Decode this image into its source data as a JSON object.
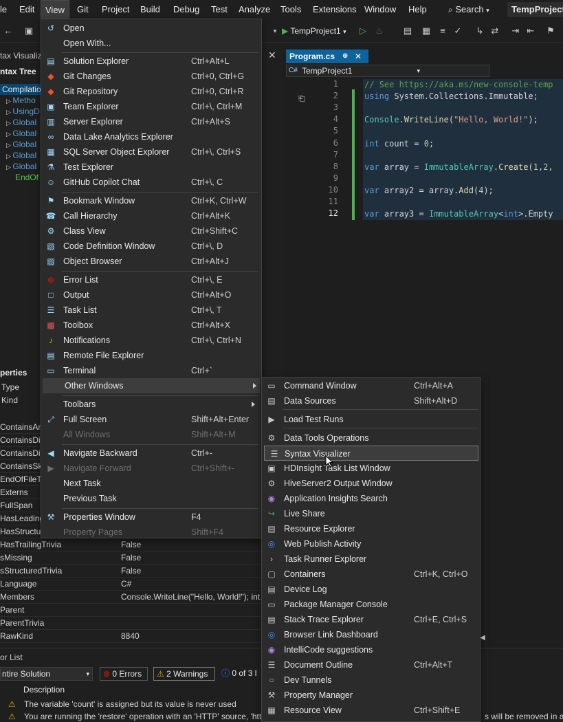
{
  "menubar": {
    "items": [
      "le",
      "Edit",
      "View",
      "Git",
      "Project",
      "Build",
      "Debug",
      "Test",
      "Analyze",
      "Tools",
      "Extensions",
      "Window",
      "Help"
    ],
    "search": "Search",
    "project": "TempProject1"
  },
  "toolbar": {
    "run_target": "TempProject1"
  },
  "left_panel": {
    "panel_title": "tax Visualiz",
    "tree_title": "ntax Tree",
    "tree_items": [
      "Compilatio",
      "Metho",
      "UsingD",
      "Global",
      "Global",
      "Global",
      "Global",
      "Global",
      "EndOf"
    ],
    "properties_title": "perties",
    "prop_header": [
      "Type",
      "Kind"
    ],
    "prop_names_top": [
      "ContainsAn",
      "ContainsDi",
      "ContainsDir",
      "ContainsSki",
      "EndOfFileTo",
      "Externs",
      "FullSpan",
      "HasLeading",
      "HasStructur"
    ],
    "props": [
      {
        "name": "HasTrailingTrivia",
        "value": "False"
      },
      {
        "name": "sMissing",
        "value": "False"
      },
      {
        "name": "sStructuredTrivia",
        "value": "False"
      },
      {
        "name": "Language",
        "value": "C#"
      },
      {
        "name": "Members",
        "value": "Console.WriteLine(\"Hello, World!\"); int"
      },
      {
        "name": "Parent",
        "value": ""
      },
      {
        "name": "ParentTrivia",
        "value": ""
      },
      {
        "name": "RawKind",
        "value": "8840"
      }
    ]
  },
  "editor": {
    "tab": "Program.cs",
    "navbar": "TempProject1",
    "lines": [
      {
        "n": "1",
        "text": "// See https://aka.ms/new-console-temp"
      },
      {
        "n": "2",
        "text": "using System.Collections.Immutable;"
      },
      {
        "n": "3",
        "text": ""
      },
      {
        "n": "4",
        "text": "Console.WriteLine(\"Hello, World!\");"
      },
      {
        "n": "5",
        "text": ""
      },
      {
        "n": "6",
        "text": "int count = 0;"
      },
      {
        "n": "7",
        "text": ""
      },
      {
        "n": "8",
        "text": "var array = ImmutableArray.Create(1,2,"
      },
      {
        "n": "9",
        "text": ""
      },
      {
        "n": "10",
        "text": "var array2 = array.Add(4);"
      },
      {
        "n": "11",
        "text": ""
      },
      {
        "n": "12",
        "text": "var array3 = ImmutableArray<int>.Empty"
      }
    ]
  },
  "error_list": {
    "title": "or List",
    "scope": "ntire Solution",
    "errors": "0 Errors",
    "warnings": "2 Warnings",
    "messages": "0 of 3 l",
    "col_description": "Description",
    "rows": [
      "The variable 'count' is assigned but its value is never used",
      "You are running the 'restore' operation with an 'HTTP' source, 'htt"
    ],
    "row2_tail": "s will be removed in a f"
  },
  "view_menu": [
    {
      "label": "Open",
      "shortcut": "",
      "icon": "open-icon"
    },
    {
      "label": "Open With...",
      "shortcut": "",
      "icon": ""
    },
    {
      "label": "Solution Explorer",
      "shortcut": "Ctrl+Alt+L",
      "icon": "solution-explorer-icon"
    },
    {
      "label": "Git Changes",
      "shortcut": "Ctrl+0, Ctrl+G",
      "icon": "git-changes-icon"
    },
    {
      "label": "Git Repository",
      "shortcut": "Ctrl+0, Ctrl+R",
      "icon": "git-repository-icon"
    },
    {
      "label": "Team Explorer",
      "shortcut": "Ctrl+\\, Ctrl+M",
      "icon": "team-explorer-icon"
    },
    {
      "label": "Server Explorer",
      "shortcut": "Ctrl+Alt+S",
      "icon": "server-explorer-icon"
    },
    {
      "label": "Data Lake Analytics Explorer",
      "shortcut": "",
      "icon": "data-lake-icon"
    },
    {
      "label": "SQL Server Object Explorer",
      "shortcut": "Ctrl+\\, Ctrl+S",
      "icon": "sql-server-icon"
    },
    {
      "label": "Test Explorer",
      "shortcut": "",
      "icon": "test-explorer-icon"
    },
    {
      "label": "GitHub Copilot Chat",
      "shortcut": "Ctrl+\\, C",
      "icon": "copilot-icon"
    },
    {
      "label": "Bookmark Window",
      "shortcut": "Ctrl+K, Ctrl+W",
      "icon": "bookmark-icon"
    },
    {
      "label": "Call Hierarchy",
      "shortcut": "Ctrl+Alt+K",
      "icon": "call-hierarchy-icon"
    },
    {
      "label": "Class View",
      "shortcut": "Ctrl+Shift+C",
      "icon": "class-view-icon"
    },
    {
      "label": "Code Definition Window",
      "shortcut": "Ctrl+\\, D",
      "icon": "code-definition-icon"
    },
    {
      "label": "Object Browser",
      "shortcut": "Ctrl+Alt+J",
      "icon": "object-browser-icon"
    },
    {
      "label": "Error List",
      "shortcut": "Ctrl+\\, E",
      "icon": "error-list-icon"
    },
    {
      "label": "Output",
      "shortcut": "Ctrl+Alt+O",
      "icon": "output-icon"
    },
    {
      "label": "Task List",
      "shortcut": "Ctrl+\\, T",
      "icon": "task-list-icon"
    },
    {
      "label": "Toolbox",
      "shortcut": "Ctrl+Alt+X",
      "icon": "toolbox-icon"
    },
    {
      "label": "Notifications",
      "shortcut": "Ctrl+\\, Ctrl+N",
      "icon": "bell-icon"
    },
    {
      "label": "Remote File Explorer",
      "shortcut": "",
      "icon": "remote-file-icon"
    },
    {
      "label": "Terminal",
      "shortcut": "Ctrl+`",
      "icon": "terminal-icon"
    },
    {
      "label": "Other Windows",
      "shortcut": "",
      "icon": ""
    },
    {
      "label": "Toolbars",
      "shortcut": "",
      "icon": ""
    },
    {
      "label": "Full Screen",
      "shortcut": "Shift+Alt+Enter",
      "icon": "full-screen-icon"
    },
    {
      "label": "All Windows",
      "shortcut": "Shift+Alt+M",
      "icon": ""
    },
    {
      "label": "Navigate Backward",
      "shortcut": "Ctrl+-",
      "icon": "navigate-back-icon"
    },
    {
      "label": "Navigate Forward",
      "shortcut": "Ctrl+Shift+-",
      "icon": "navigate-forward-icon"
    },
    {
      "label": "Next Task",
      "shortcut": "",
      "icon": ""
    },
    {
      "label": "Previous Task",
      "shortcut": "",
      "icon": ""
    },
    {
      "label": "Properties Window",
      "shortcut": "F4",
      "icon": "wrench-icon"
    },
    {
      "label": "Property Pages",
      "shortcut": "Shift+F4",
      "icon": ""
    }
  ],
  "other_windows_menu": [
    {
      "label": "Command Window",
      "shortcut": "Ctrl+Alt+A"
    },
    {
      "label": "Data Sources",
      "shortcut": "Shift+Alt+D"
    },
    {
      "label": "Load Test Runs",
      "shortcut": ""
    },
    {
      "label": "Data Tools Operations",
      "shortcut": ""
    },
    {
      "label": "Syntax Visualizer",
      "shortcut": ""
    },
    {
      "label": "HDInsight Task List Window",
      "shortcut": ""
    },
    {
      "label": "HiveServer2 Output Window",
      "shortcut": ""
    },
    {
      "label": "Application Insights Search",
      "shortcut": ""
    },
    {
      "label": "Live Share",
      "shortcut": ""
    },
    {
      "label": "Resource Explorer",
      "shortcut": ""
    },
    {
      "label": "Web Publish Activity",
      "shortcut": ""
    },
    {
      "label": "Task Runner Explorer",
      "shortcut": ""
    },
    {
      "label": "Containers",
      "shortcut": "Ctrl+K, Ctrl+O"
    },
    {
      "label": "Device Log",
      "shortcut": ""
    },
    {
      "label": "Package Manager Console",
      "shortcut": ""
    },
    {
      "label": "Stack Trace Explorer",
      "shortcut": "Ctrl+E, Ctrl+S"
    },
    {
      "label": "Browser Link Dashboard",
      "shortcut": ""
    },
    {
      "label": "IntelliCode suggestions",
      "shortcut": ""
    },
    {
      "label": "Document Outline",
      "shortcut": "Ctrl+Alt+T"
    },
    {
      "label": "Dev Tunnels",
      "shortcut": ""
    },
    {
      "label": "Property Manager",
      "shortcut": ""
    },
    {
      "label": "Resource View",
      "shortcut": "Ctrl+Shift+E"
    }
  ]
}
